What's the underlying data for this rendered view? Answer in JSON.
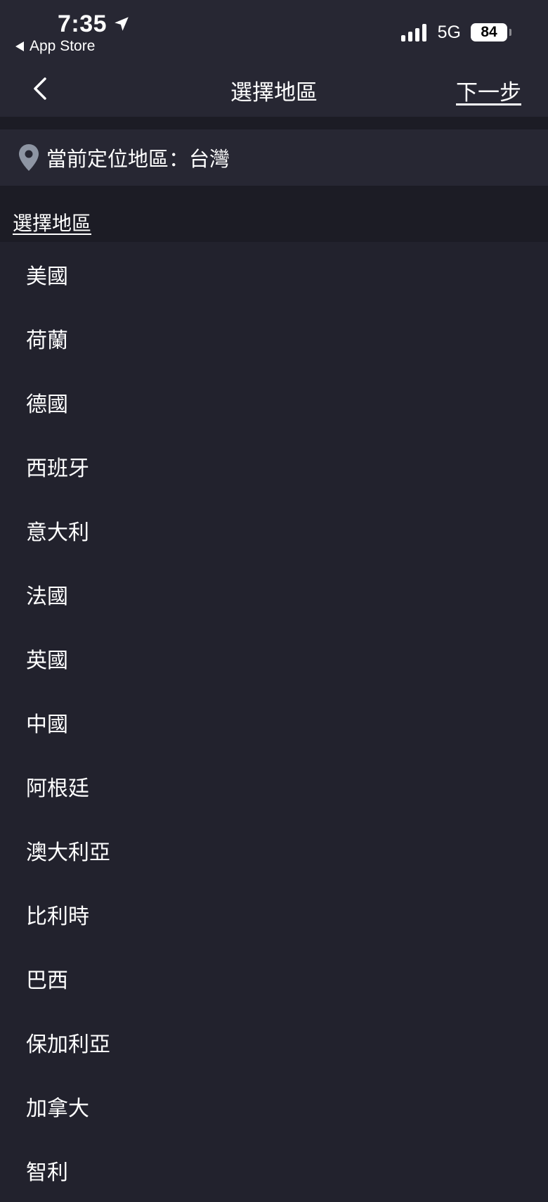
{
  "status_bar": {
    "time": "7:35",
    "back_app": "App Store",
    "network": "5G",
    "battery": "84",
    "signal_bars": 4
  },
  "nav": {
    "title": "選擇地區",
    "next": "下一步"
  },
  "current_location": {
    "text": "當前定位地區：台灣"
  },
  "section": {
    "header": "選擇地區"
  },
  "regions": [
    "美國",
    "荷蘭",
    "德國",
    "西班牙",
    "意大利",
    "法國",
    "英國",
    "中國",
    "阿根廷",
    "澳大利亞",
    "比利時",
    "巴西",
    "保加利亞",
    "加拿大",
    "智利"
  ],
  "colors": {
    "background": "#22222d",
    "bar_background": "#272733",
    "divider": "#1c1c25",
    "text": "#ffffff",
    "pin": "#8e95a3"
  }
}
